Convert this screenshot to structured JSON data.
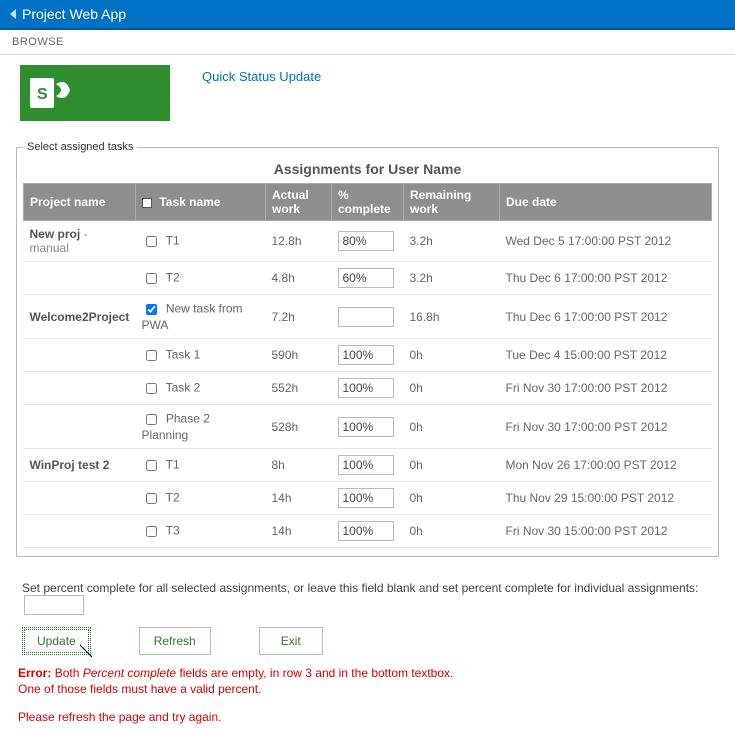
{
  "titlebar": {
    "app_name": "Project Web App"
  },
  "ribbon": {
    "browse": "BROWSE"
  },
  "header": {
    "quick_link": "Quick Status Update"
  },
  "fieldset_legend": "Select assigned tasks",
  "table_caption": "Assignments for User Name",
  "columns": {
    "project": "Project name",
    "task": "Task name",
    "actual": "Actual work",
    "pct": "% complete",
    "remaining": "Remaining work",
    "due": "Due date"
  },
  "rows": [
    {
      "project": "New proj - manual",
      "task": "T1",
      "checked": false,
      "actual": "12.8h",
      "pct": "80%",
      "remaining": "3.2h",
      "due": "Wed Dec 5 17:00:00 PST 2012"
    },
    {
      "project": "",
      "task": "T2",
      "checked": false,
      "actual": "4.8h",
      "pct": "60%",
      "remaining": "3.2h",
      "due": "Thu Dec 6 17:00:00 PST 2012"
    },
    {
      "project": "Welcome2Project",
      "task": "New task from PWA",
      "checked": true,
      "actual": "7.2h",
      "pct": "",
      "remaining": "16.8h",
      "due": "Thu Dec 6 17:00:00 PST 2012"
    },
    {
      "project": "",
      "task": "Task 1",
      "checked": false,
      "actual": "590h",
      "pct": "100%",
      "remaining": "0h",
      "due": "Tue Dec 4 15:00:00 PST 2012"
    },
    {
      "project": "",
      "task": "Task 2",
      "checked": false,
      "actual": "552h",
      "pct": "100%",
      "remaining": "0h",
      "due": "Fri Nov 30 17:00:00 PST 2012"
    },
    {
      "project": "",
      "task": "Phase 2 Planning",
      "checked": false,
      "actual": "528h",
      "pct": "100%",
      "remaining": "0h",
      "due": "Fri Nov 30 17:00:00 PST 2012"
    },
    {
      "project": "WinProj test 2",
      "task": "T1",
      "checked": false,
      "actual": "8h",
      "pct": "100%",
      "remaining": "0h",
      "due": "Mon Nov 26 17:00:00 PST 2012"
    },
    {
      "project": "",
      "task": "T2",
      "checked": false,
      "actual": "14h",
      "pct": "100%",
      "remaining": "0h",
      "due": "Thu Nov 29 15:00:00 PST 2012"
    },
    {
      "project": "",
      "task": "T3",
      "checked": false,
      "actual": "14h",
      "pct": "100%",
      "remaining": "0h",
      "due": "Fri Nov 30 15:00:00 PST 2012"
    }
  ],
  "bulk": {
    "text": "Set percent complete for all selected assignments, or leave this field blank and set percent complete for individual assignments:",
    "value": ""
  },
  "buttons": {
    "update": "Update",
    "refresh": "Refresh",
    "exit": "Exit"
  },
  "error": {
    "line1_prefix": "Error:",
    "line1_rest": " Both Percent complete fields are empty, in row 3 and in the bottom textbox.",
    "line2": "One of those fields must have a valid percent.",
    "line3": "Please refresh the page and try again."
  }
}
